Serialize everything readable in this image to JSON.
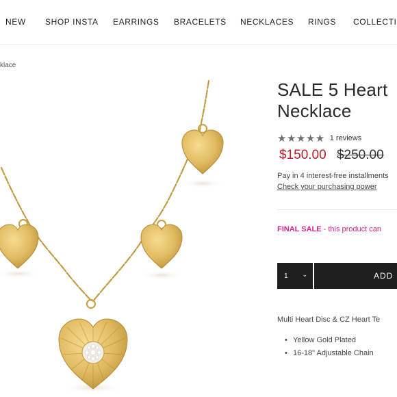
{
  "nav": {
    "items": [
      "NEW",
      "SHOP INSTA",
      "EARRINGS",
      "BRACELETS",
      "NECKLACES",
      "RINGS",
      "COLLECTIO"
    ]
  },
  "breadcrumb": "klace",
  "product": {
    "title_line1": "SALE 5 Heart",
    "title_line2": "Necklace",
    "rating": 5,
    "stars": "★★★★★",
    "reviews": "1 reviews",
    "price_sale": "$150.00",
    "price_original": "$250.00",
    "installments": "Pay in 4 interest-free installments",
    "installments_link": "Check your purchasing power",
    "final_sale_label": "FINAL SALE",
    "final_sale_text": " - this product can",
    "quantity": "1",
    "add_button": "ADD",
    "description": "Multi Heart Disc & CZ Heart Te",
    "features": [
      "Yellow Gold Plated",
      "16-18\" Adjustable Chain"
    ]
  },
  "colors": {
    "sale_price": "#b81c23",
    "final_sale": "#d1288d",
    "button_bg": "#1f1f1f",
    "gold": "#d9b45a"
  }
}
